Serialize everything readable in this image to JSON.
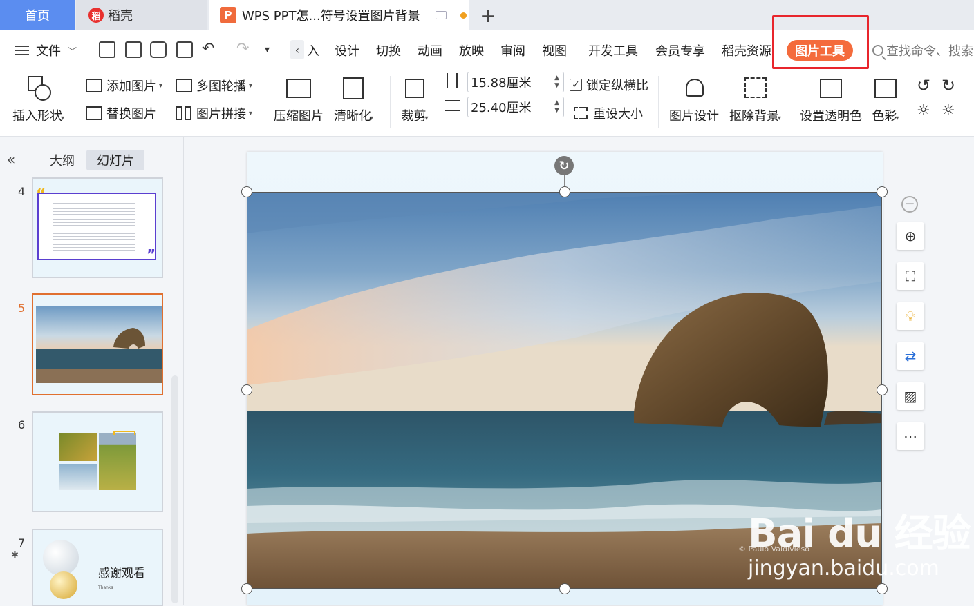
{
  "tabs": {
    "home": "首页",
    "daoke": "稻壳",
    "doc": "WPS PPT怎...符号设置图片背景",
    "doc_logo": "P",
    "daoke_logo": "稻",
    "new_tab": "+"
  },
  "menu": {
    "file": "文件",
    "items": [
      "入",
      "设计",
      "切换",
      "动画",
      "放映",
      "审阅",
      "视图",
      "开发工具",
      "会员专享",
      "稻壳资源"
    ],
    "active_tab": "图片工具",
    "search_placeholder": "查找命令、搜索"
  },
  "ribbon": {
    "insert_shape": "插入形状",
    "add_picture": "添加图片",
    "replace_picture": "替换图片",
    "multi_carousel": "多图轮播",
    "picture_collage": "图片拼接",
    "compress": "压缩图片",
    "sharpen": "清晰化",
    "crop": "裁剪",
    "height_value": "15.88厘米",
    "width_value": "25.40厘米",
    "lock_ratio": "锁定纵横比",
    "reset_size": "重设大小",
    "picture_design": "图片设计",
    "remove_bg": "抠除背景",
    "set_transparent": "设置透明色",
    "color": "色彩"
  },
  "panel": {
    "collapse": "«",
    "outline_tab": "大纲",
    "slides_tab": "幻灯片",
    "slides": [
      {
        "num": "4"
      },
      {
        "num": "5"
      },
      {
        "num": "6"
      },
      {
        "num": "7",
        "title": "感谢观看",
        "subtitle": "Thanks"
      }
    ]
  },
  "canvas": {
    "photo_credit": "© Paulo Valdivieso",
    "watermark_logo": "Bai du 经验",
    "watermark_url": "jingyan.baidu.com"
  },
  "float_toolbar": [
    "zoom-in",
    "crop",
    "smart-tips",
    "convert",
    "fill",
    "more"
  ],
  "colors": {
    "accent_orange": "#f46b3c",
    "home_tab_blue": "#5b8df0",
    "highlight_red": "#e8252c",
    "active_slide_border": "#e07030"
  }
}
